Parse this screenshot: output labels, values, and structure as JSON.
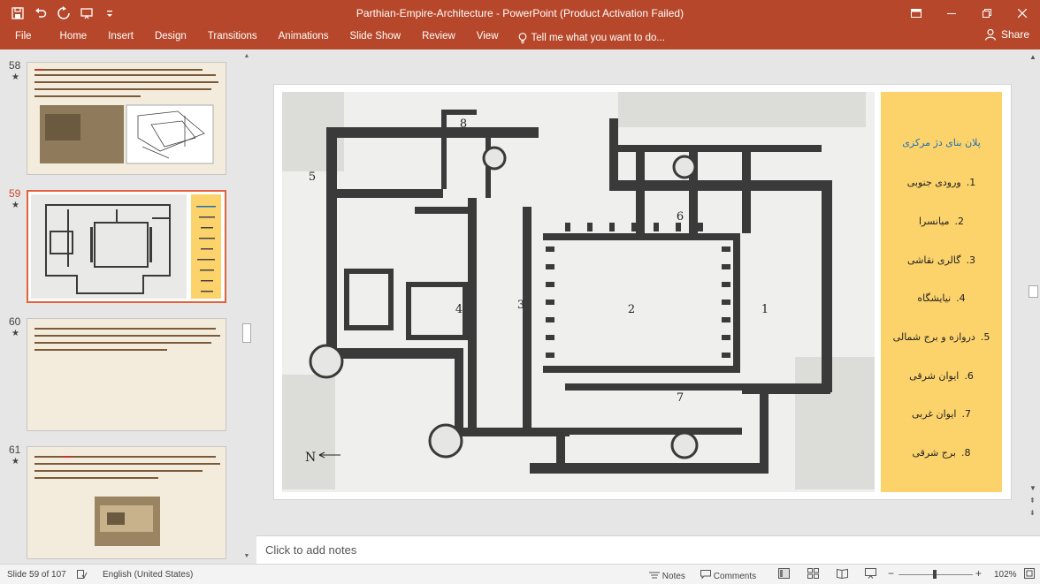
{
  "window": {
    "title": "Parthian-Empire-Architecture - PowerPoint (Product Activation Failed)"
  },
  "ribbon": {
    "file": "File",
    "tabs": [
      "Home",
      "Insert",
      "Design",
      "Transitions",
      "Animations",
      "Slide Show",
      "Review",
      "View"
    ],
    "tell_me": "Tell me what you want to do...",
    "share": "Share"
  },
  "thumbnails": [
    {
      "number": "58",
      "star": "★"
    },
    {
      "number": "59",
      "star": "★"
    },
    {
      "number": "60",
      "star": "★"
    },
    {
      "number": "61",
      "star": "★"
    }
  ],
  "slide": {
    "legend_title": "پلان بنای دژ مرکزی",
    "legend_items": [
      {
        "n": "1.",
        "label": "ورودی جنوبی"
      },
      {
        "n": "2.",
        "label": "میانسرا"
      },
      {
        "n": "3.",
        "label": "گالری نقاشی"
      },
      {
        "n": "4.",
        "label": "نیایشگاه"
      },
      {
        "n": "5.",
        "label": "دروازه و برج شمالی"
      },
      {
        "n": "6.",
        "label": "ایوان شرقی"
      },
      {
        "n": "7.",
        "label": "ایوان غربی"
      },
      {
        "n": "8.",
        "label": "برج شرقی"
      }
    ],
    "plan_labels": [
      "1",
      "2",
      "3",
      "4",
      "5",
      "6",
      "7",
      "8"
    ],
    "north_label": "N"
  },
  "notes_placeholder": "Click to add notes",
  "status": {
    "slide_info": "Slide 59 of 107",
    "language": "English (United States)",
    "notes": "Notes",
    "comments": "Comments",
    "zoom": "102%"
  },
  "colors": {
    "accent": "#b7472a",
    "legend_bg": "#fcd36b",
    "legend_title": "#1f6fb5",
    "active_thumb": "#e3623a"
  }
}
